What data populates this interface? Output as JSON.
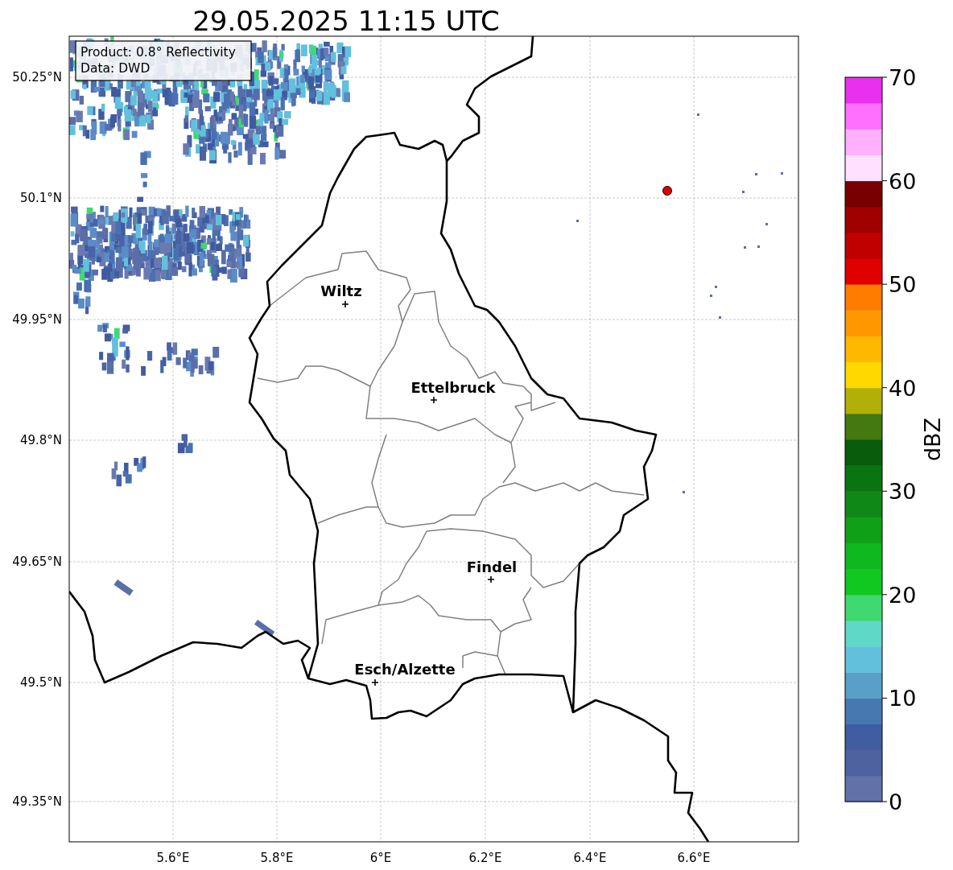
{
  "title": "29.05.2025 11:15 UTC",
  "info_box": {
    "lines": [
      "Product: 0.8° Reflectivity",
      "Data: DWD"
    ]
  },
  "map": {
    "y_ticks": [
      "50.25°N",
      "50.1°N",
      "49.95°N",
      "49.8°N",
      "49.65°N",
      "49.5°N",
      "49.35°N"
    ],
    "x_ticks": [
      "5.6°E",
      "5.8°E",
      "6°E",
      "6.2°E",
      "6.4°E",
      "6.6°E"
    ],
    "cities": [
      {
        "name": "Wiltz"
      },
      {
        "name": "Ettelbruck"
      },
      {
        "name": "Findel"
      },
      {
        "name": "Esch/Alzette"
      }
    ]
  },
  "colorbar": {
    "label": "dBZ",
    "ticks": [
      "70",
      "60",
      "50",
      "40",
      "30",
      "20",
      "10",
      "0"
    ]
  }
}
